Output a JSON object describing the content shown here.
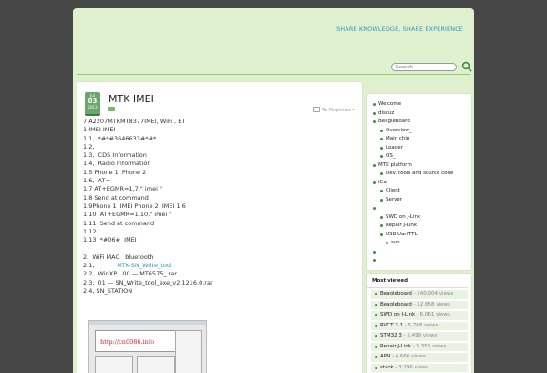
{
  "header": {
    "tagline": "SHARE KNOWLEDGE, SHARE EXPERIENCE",
    "search_placeholder": "Search"
  },
  "post": {
    "date": {
      "month": "Jul",
      "day": "03",
      "year": "2013"
    },
    "title": "MTK IMEI",
    "comments": "No Responses »",
    "lines": [
      "7 A2207MTKMT8377IMEI, WiFi , BT",
      "1 IMEI IMEI",
      "1.1,  *#*#3646633#*#*",
      "1.2,",
      "1.3,  CDS Information",
      "1.4,  Radio Information",
      "1.5 Phone 1  Phone 2",
      "1.6,  AT+",
      "1.7 AT+EGMR=1,7,\" imei \"",
      "1.8 Send at command",
      "1.9Phone 1  IMEI Phone 2  IMEI 1.6",
      "1.10  AT+EGMR=1,10,\" imei \"",
      "1.11  Send at command",
      "1.12",
      "1.13  *#06#  IMEI",
      "",
      "2,  WiFi MAC   bluetooth",
      "2.1,",
      "2.2,  WinXP,  00 — MT6575_.rar",
      "2.3,  01 — SN_Write_tool_exe_v2.1216.0.rar",
      "2.4, SN_STATION"
    ],
    "link_text": "MTK-SN_Write_tool",
    "watermark": "http://cn0086.info"
  },
  "sidebar": {
    "nav": [
      {
        "label": "Welcome",
        "level": 0
      },
      {
        "label": "discuz",
        "level": 0
      },
      {
        "label": "Beagleboard",
        "level": 0
      },
      {
        "label": "Overview_",
        "level": 1
      },
      {
        "label": "Main chip",
        "level": 1
      },
      {
        "label": "Loader_",
        "level": 1
      },
      {
        "label": "OS_",
        "level": 1
      },
      {
        "label": "MTK platform",
        "level": 0
      },
      {
        "label": "Dev. tools and source code",
        "level": 1
      },
      {
        "label": "iCar",
        "level": 0
      },
      {
        "label": "Client",
        "level": 1
      },
      {
        "label": "Server",
        "level": 1
      },
      {
        "label": "",
        "level": 0
      },
      {
        "label": "SWD on J-Link",
        "level": 1
      },
      {
        "label": "Repair J-Link",
        "level": 1
      },
      {
        "label": "USB  UartTTL",
        "level": 1
      },
      {
        "label": "svn",
        "level": 2
      },
      {
        "label": "",
        "level": 0
      },
      {
        "label": "",
        "level": 0
      }
    ],
    "most_viewed_title": "Most viewed",
    "most_viewed": [
      {
        "title": "Beagleboard",
        "views": "- 140,004 views"
      },
      {
        "title": "Beagleboard",
        "views": "- 12,658 views"
      },
      {
        "title": "SWD on J-Link",
        "views": "- 6,061 views"
      },
      {
        "title": "RVCT 3.1",
        "views": "- 5,768 views"
      },
      {
        "title": "STM32 3",
        "views": "- 5,499 views"
      },
      {
        "title": "Repair J-Link",
        "views": "- 5,356 views"
      },
      {
        "title": "APN",
        "views": "- 4,666 views"
      },
      {
        "title": "stack",
        "views": "- 3,296 views"
      }
    ]
  },
  "colors": {
    "accent": "#2f97c3",
    "green": "#6aa56a",
    "page_bg": "#dff0cf",
    "outer_bg": "#474747"
  }
}
